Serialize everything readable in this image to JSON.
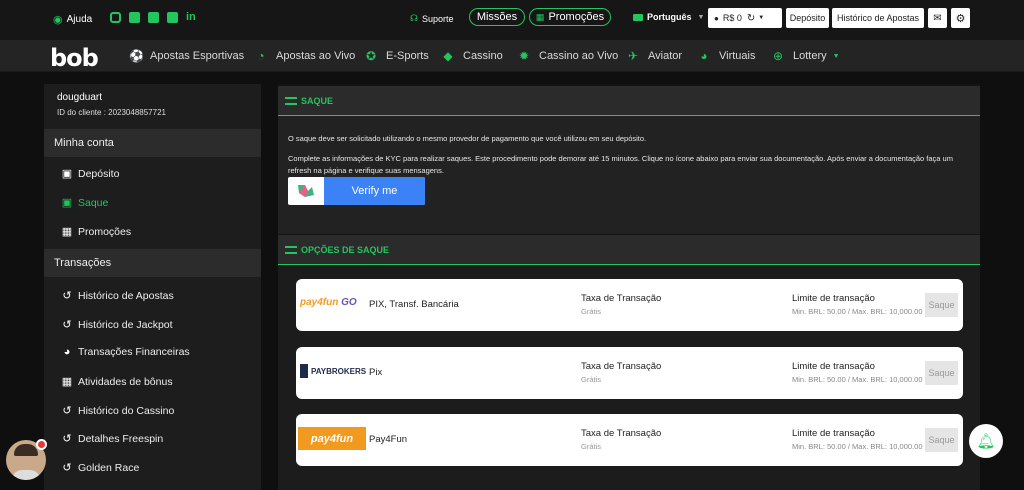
{
  "topbar": {
    "help": "Ajuda",
    "support": "Suporte",
    "missions": "Missões",
    "promotions": "Promoções",
    "language": "Português",
    "balance": "R$ 0",
    "deposit": "Depósito",
    "bet_history": "Histórico de Apostas"
  },
  "brand": {
    "logo": "bob"
  },
  "nav": {
    "items": [
      {
        "label": "Apostas Esportivas"
      },
      {
        "label": "Apostas ao Vivo"
      },
      {
        "label": "E-Sports"
      },
      {
        "label": "Cassino"
      },
      {
        "label": "Cassino ao Vivo"
      },
      {
        "label": "Aviator"
      },
      {
        "label": "Virtuais"
      },
      {
        "label": "Lottery"
      }
    ]
  },
  "sidebar": {
    "username": "dougduart",
    "client_id": "ID do cliente : 2023048857721",
    "sections": {
      "account": "Minha conta",
      "transactions": "Transações"
    },
    "account_items": [
      {
        "label": "Depósito"
      },
      {
        "label": "Saque"
      },
      {
        "label": "Promoções"
      }
    ],
    "transaction_items": [
      {
        "label": "Histórico de Apostas"
      },
      {
        "label": "Histórico de Jackpot"
      },
      {
        "label": "Transações Financeiras"
      },
      {
        "label": "Atividades de bônus"
      },
      {
        "label": "Histórico do Cassino"
      },
      {
        "label": "Detalhes Freespin"
      },
      {
        "label": "Golden Race"
      }
    ]
  },
  "saque": {
    "title": "SAQUE",
    "line1": "O saque deve ser solicitado utilizando o mesmo provedor de pagamento que você utilizou em seu depósito.",
    "line2": "Complete as informações de KYC para realizar saques. Este procedimento pode demorar até 15 minutos. Clique no ícone abaixo para enviar sua documentação. Após enviar a documentação faça um refresh na página e verifique suas mensagens.",
    "verify_label": "Verify me"
  },
  "options": {
    "title": "OPÇÕES DE SAQUE",
    "fee_header": "Taxa de Transação",
    "limit_header": "Limite de transação",
    "button": "Saque",
    "methods": [
      {
        "name": "PIX, Transf. Bancária",
        "fee": "Grátis",
        "limit": "Min. BRL: 50.00 / Max. BRL: 10,000.00",
        "logo": "payfun GO"
      },
      {
        "name": "Pix",
        "fee": "Grátis",
        "limit": "Min. BRL: 50.00 / Max. BRL: 10,000.00",
        "logo": "PAYBROKERS"
      },
      {
        "name": "Pay4Fun",
        "fee": "Grátis",
        "limit": "Min. BRL: 50.00 / Max. BRL: 10,000.00",
        "logo": "pay4fun"
      }
    ]
  },
  "colors": {
    "accent": "#22c55e",
    "verify": "#3b82f6",
    "payfun_orange": "#f29a1f"
  }
}
